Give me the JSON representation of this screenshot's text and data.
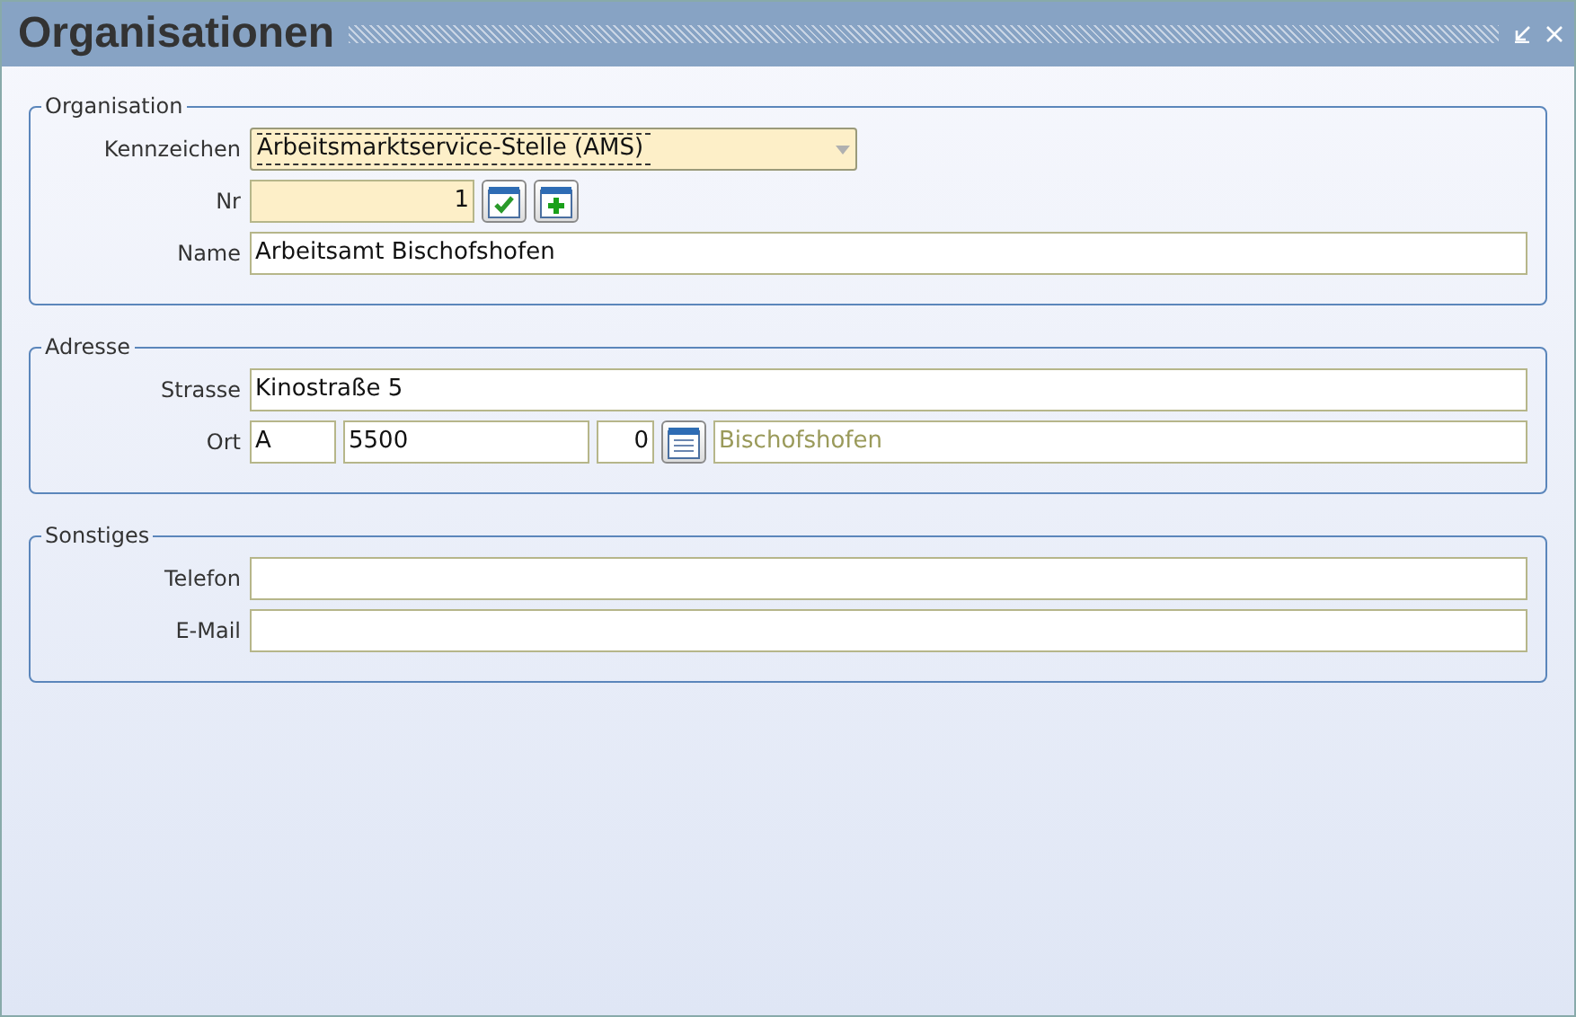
{
  "window": {
    "title": "Organisationen"
  },
  "sections": [
    {
      "legend": "Organisation",
      "rows": [
        {
          "kind": "select",
          "label": "Kennzeichen",
          "value": "Arbeitsmarktservice-Stelle (AMS)",
          "required": true,
          "focused": true
        },
        {
          "kind": "number",
          "label": "Nr",
          "value": "1",
          "required": true
        },
        {
          "kind": "text",
          "label": "Name",
          "value": "Arbeitsamt Bischofshofen",
          "required": false
        }
      ]
    },
    {
      "legend": "Adresse",
      "rows": [
        {
          "kind": "text",
          "label": "Strasse",
          "value": "Kinostraße 5",
          "required": false
        },
        {
          "kind": "place",
          "label": "Ort",
          "country": "A",
          "postcode": "5500",
          "code": "0",
          "city": "Bischofshofen",
          "city_disabled": true
        }
      ]
    },
    {
      "legend": "Sonstiges",
      "rows": [
        {
          "kind": "text",
          "label": "Telefon",
          "value": "",
          "required": false
        },
        {
          "kind": "text",
          "label": "E-Mail",
          "value": "",
          "required": false
        }
      ]
    }
  ]
}
